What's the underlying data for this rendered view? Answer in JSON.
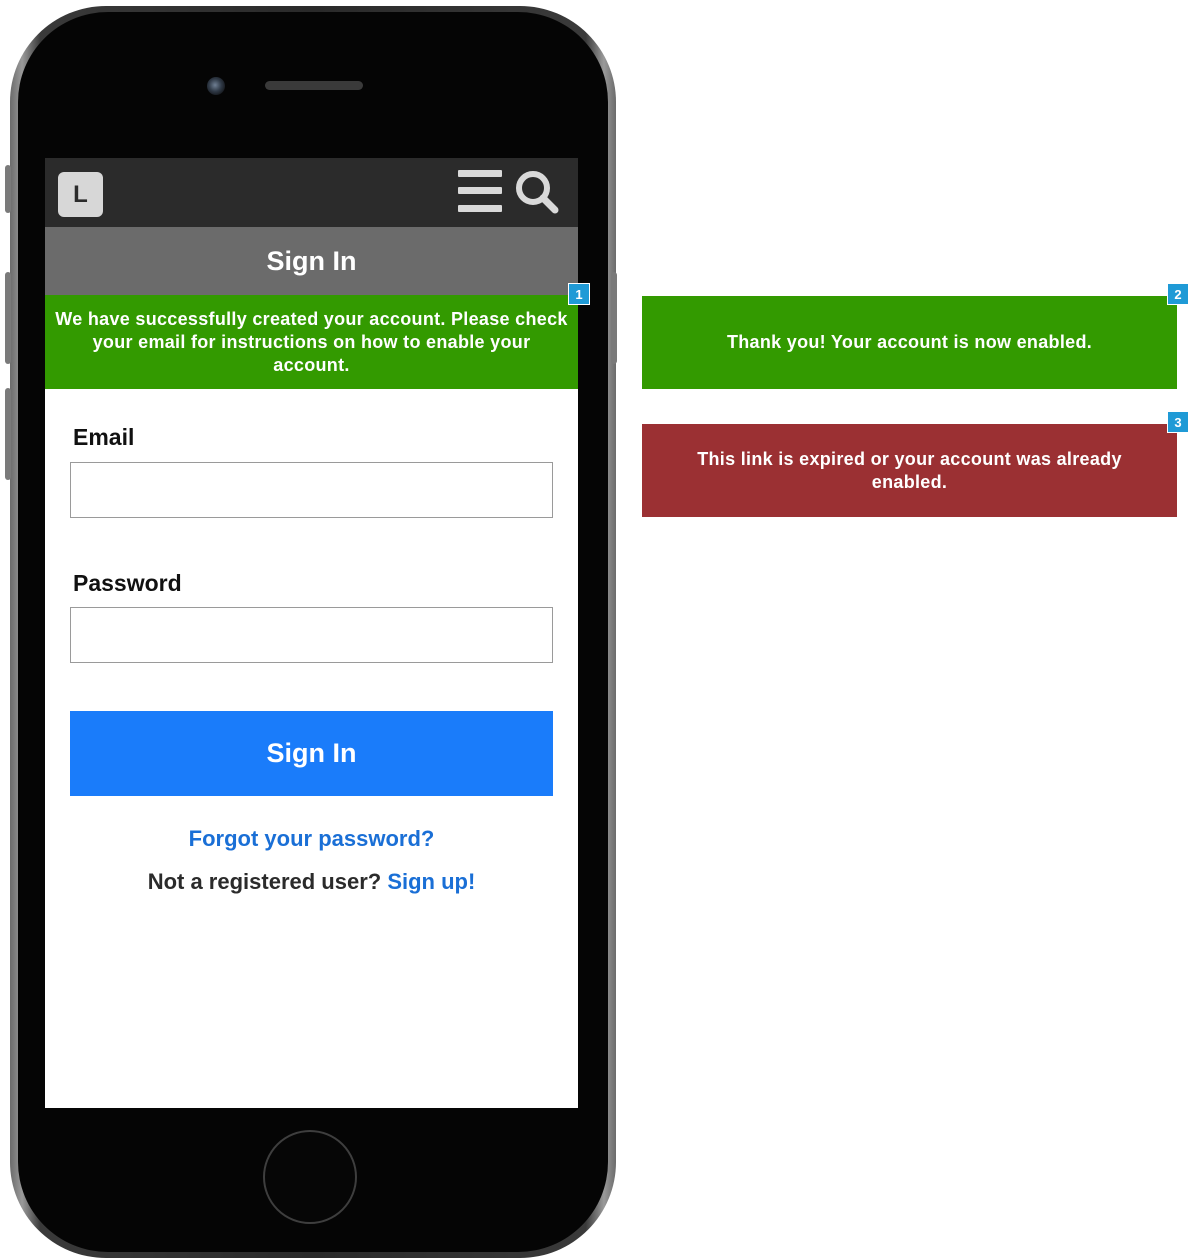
{
  "app": {
    "logo_letter": "L",
    "page_title": "Sign In"
  },
  "notice": {
    "account_created": "We have successfully created your account. Please check your email for instructions on how to enable your account."
  },
  "form": {
    "email_label": "Email",
    "email_value": "",
    "password_label": "Password",
    "password_value": "",
    "signin_label": "Sign In",
    "forgot_link": "Forgot your password?",
    "signup_prompt": "Not a registered user?",
    "signup_link": "Sign up!"
  },
  "annotations": {
    "marker_1": "1",
    "marker_2": "2",
    "marker_3": "3",
    "enabled_message": "Thank you! Your account is now enabled.",
    "expired_message": "This link is expired or your account was already enabled."
  },
  "icons": {
    "menu": "hamburger-menu-icon",
    "search": "search-icon"
  },
  "colors": {
    "header": "#2b2b2b",
    "title_bar": "#6b6b6b",
    "success": "#339a00",
    "error": "#9b3033",
    "primary_button": "#1a7cfa",
    "link": "#1a6fd6",
    "marker": "#1f9ad6"
  }
}
